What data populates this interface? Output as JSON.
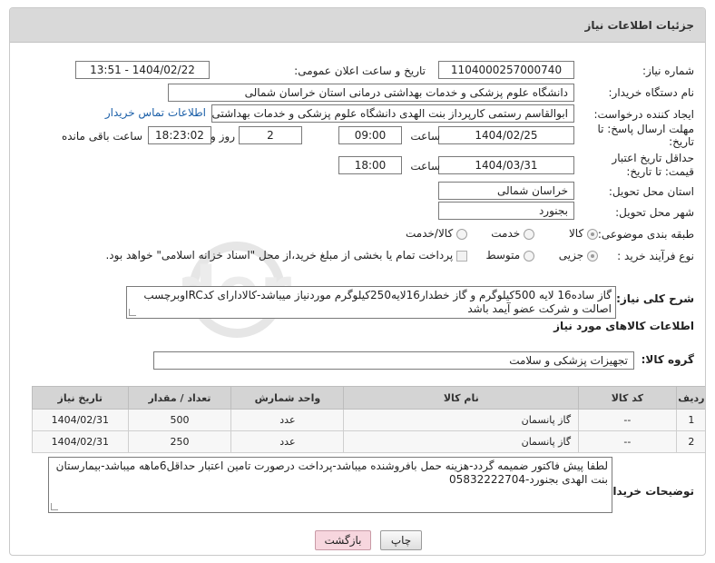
{
  "panel_title": "جزئیات اطلاعات نیاز",
  "fields": {
    "need_number_label": "شماره نیاز:",
    "need_number": "1104000257000740",
    "announce_datetime_label": "تاریخ و ساعت اعلان عمومی:",
    "announce_datetime": "1404/02/22 - 13:51",
    "buyer_org_label": "نام دستگاه خریدار:",
    "buyer_org": "دانشگاه علوم پزشکی و خدمات بهداشتی درمانی استان خراسان شمالی",
    "requester_label": "ایجاد کننده درخواست:",
    "requester": "ابوالقاسم رستمی کارپرداز بنت الهدی دانشگاه علوم پزشکی و خدمات بهداشتی",
    "buyer_contact_link": "اطلاعات تماس خریدار",
    "deadline_label": "مهلت ارسال پاسخ: تا تاریخ:",
    "deadline_date": "1404/02/25",
    "deadline_time_label": "ساعت",
    "deadline_time": "09:00",
    "days_value": "2",
    "days_label": "روز و",
    "remaining_time": "18:23:02",
    "remaining_label": "ساعت باقی مانده",
    "price_validity_label": "حداقل تاریخ اعتبار قیمت: تا تاریخ:",
    "price_validity_date": "1404/03/31",
    "price_validity_time_label": "ساعت",
    "price_validity_time": "18:00",
    "delivery_province_label": "استان محل تحویل:",
    "delivery_province": "خراسان شمالی",
    "delivery_city_label": "شهر محل تحویل:",
    "delivery_city": "بجنورد",
    "category_label": "طبقه بندی موضوعی:",
    "category_options": [
      "کالا",
      "خدمت",
      "کالا/خدمت"
    ],
    "category_selected": "کالا",
    "purchase_type_label": "نوع فرآیند خرید :",
    "purchase_options": [
      "جزیی",
      "متوسط"
    ],
    "purchase_selected": "جزیی",
    "payment_note": "پرداخت تمام یا بخشی از مبلغ خرید،از محل \"اسناد خزانه اسلامی\" خواهد بود."
  },
  "description": {
    "label": "شرح کلی نیاز:",
    "text": "گاز ساده16 لایه 500کیلوگرم و گاز خطدار16لایه250کیلوگرم موردنیاز میباشد-کالادارای کدIRCوبرچسب اصالت و شرکت عضو آیمد باشد"
  },
  "goods_section_title": "اطلاعات کالاهای مورد نیاز",
  "goods_group_label": "گروه کالا:",
  "goods_group": "تجهیزات پزشکی و سلامت",
  "table": {
    "headers": [
      "ردیف",
      "کد کالا",
      "نام کالا",
      "واحد شمارش",
      "تعداد / مقدار",
      "تاریخ نیاز"
    ],
    "rows": [
      [
        "1",
        "--",
        "گاز پانسمان",
        "عدد",
        "500",
        "1404/02/31"
      ],
      [
        "2",
        "--",
        "گاز پانسمان",
        "عدد",
        "250",
        "1404/02/31"
      ]
    ]
  },
  "buyer_notes": {
    "label": "توضیحات خریدار:",
    "text": "لطفا پیش فاکتور ضمیمه گردد-هزینه حمل بافروشنده میباشد-پرداخت درصورت تامین اعتبار حداقل6ماهه میباشد-بیمارستان بنت الهدی بجنورد-05832222704"
  },
  "buttons": {
    "print": "چاپ",
    "back": "بازگشت"
  },
  "colors": {
    "header_bg": "#d9d9d9",
    "link": "#1b5fa8",
    "back_button": "#f7d6de"
  }
}
